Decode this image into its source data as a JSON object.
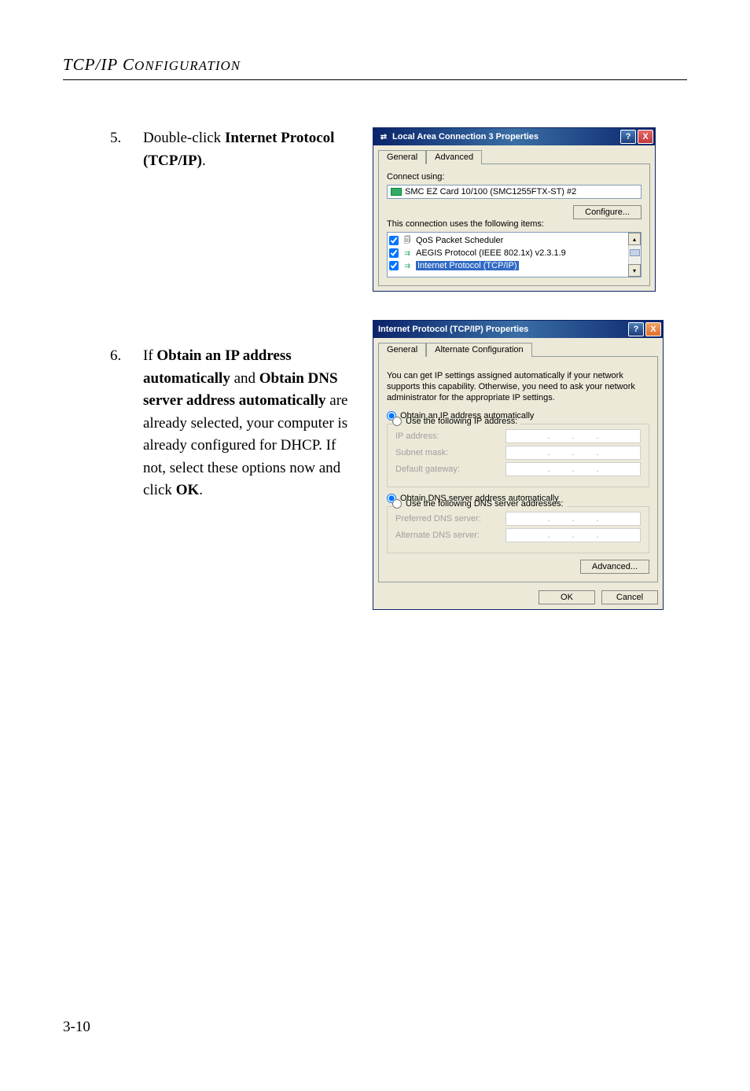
{
  "header": "TCP/IP CONFIGURATION",
  "header_small": "ONFIGURATION",
  "header_pre": "TCP/IP C",
  "step5_num": "5.",
  "step5_pre": "Double-click ",
  "step5_bold": "Internet Protocol (TCP/IP)",
  "step5_post": ".",
  "step6_num": "6.",
  "step6_pre": "If ",
  "step6_bold1": "Obtain an IP address automatically",
  "step6_mid1": " and ",
  "step6_bold2": "Obtain DNS server address automatically",
  "step6_mid2": " are already selected, your computer is already configured for DHCP. If not, select these options now and click ",
  "step6_bold3": "OK",
  "step6_post": ".",
  "dialog1": {
    "title": "Local Area Connection 3 Properties",
    "tabs": {
      "general": "General",
      "advanced": "Advanced"
    },
    "connect_using": "Connect using:",
    "nic": "SMC EZ Card 10/100 (SMC1255FTX-ST) #2",
    "configure": "Configure...",
    "items_label": "This connection uses the following items:",
    "items": [
      {
        "label": "QoS Packet Scheduler"
      },
      {
        "label": "AEGIS Protocol (IEEE 802.1x) v2.3.1.9"
      },
      {
        "label": "Internet Protocol (TCP/IP)"
      }
    ]
  },
  "dialog2": {
    "title": "Internet Protocol (TCP/IP) Properties",
    "tabs": {
      "general": "General",
      "alt": "Alternate Configuration"
    },
    "description": "You can get IP settings assigned automatically if your network supports this capability. Otherwise, you need to ask your network administrator for the appropriate IP settings.",
    "radio_auto_ip": "Obtain an IP address automatically",
    "radio_manual_ip": "Use the following IP address:",
    "ip_label": "IP address:",
    "subnet_label": "Subnet mask:",
    "gateway_label": "Default gateway:",
    "radio_auto_dns": "Obtain DNS server address automatically",
    "radio_manual_dns": "Use the following DNS server addresses:",
    "preferred_dns": "Preferred DNS server:",
    "alternate_dns": "Alternate DNS server:",
    "advanced": "Advanced...",
    "ok": "OK",
    "cancel": "Cancel"
  },
  "page_number": "3-10",
  "icons": {
    "help": "?",
    "close": "X",
    "up": "▴",
    "down": "▾",
    "network": "⇄"
  }
}
